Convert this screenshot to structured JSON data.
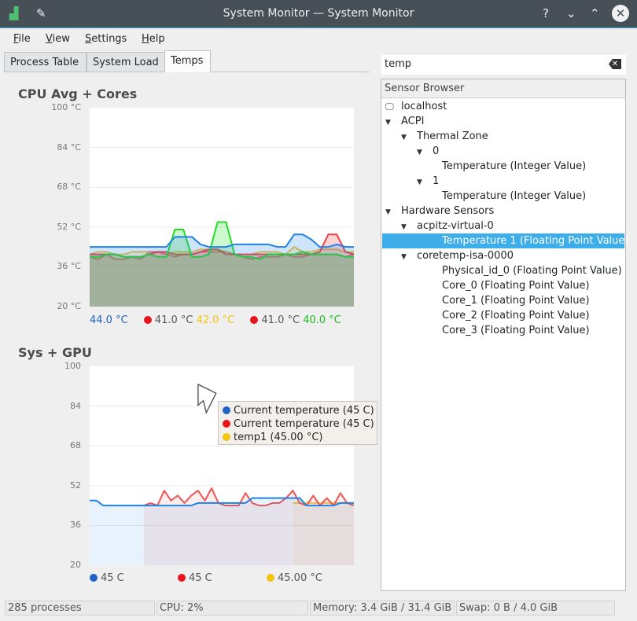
{
  "window": {
    "title": "System Monitor — System Monitor",
    "controls": [
      "?",
      "⌄",
      "⌃",
      "✕"
    ]
  },
  "menu": [
    "File",
    "View",
    "Settings",
    "Help"
  ],
  "tabs": [
    "Process Table",
    "System Load",
    "Temps"
  ],
  "active_tab": "Temps",
  "search": {
    "value": "temp"
  },
  "sensor_browser": {
    "header": "Sensor Browser",
    "items": [
      {
        "label": "localhost",
        "level": 0,
        "icon": "computer-icon"
      },
      {
        "label": "ACPI",
        "level": 0,
        "expanded": true
      },
      {
        "label": "Thermal Zone",
        "level": 1,
        "expanded": true
      },
      {
        "label": "0",
        "level": 2,
        "expanded": true
      },
      {
        "label": "Temperature (Integer Value)",
        "level": 3
      },
      {
        "label": "1",
        "level": 2,
        "expanded": true
      },
      {
        "label": "Temperature (Integer Value)",
        "level": 3
      },
      {
        "label": "Hardware Sensors",
        "level": 0,
        "expanded": true
      },
      {
        "label": "acpitz-virtual-0",
        "level": 1,
        "expanded": true
      },
      {
        "label": "Temperature 1 (Floating Point Value)",
        "level": 3,
        "selected": true
      },
      {
        "label": "coretemp-isa-0000",
        "level": 1,
        "expanded": true
      },
      {
        "label": "Physical_id_0 (Floating Point Value)",
        "level": 3
      },
      {
        "label": "Core_0 (Floating Point Value)",
        "level": 3
      },
      {
        "label": "Core_1 (Floating Point Value)",
        "level": 3
      },
      {
        "label": "Core_2 (Floating Point Value)",
        "level": 3
      },
      {
        "label": "Core_3 (Floating Point Value)",
        "level": 3
      }
    ]
  },
  "status": [
    "285 processes",
    "CPU: 2%",
    "Memory: 3.4 GiB / 31.4 GiB",
    "Swap: 0 B / 4.0 GiB"
  ],
  "tooltip": [
    {
      "label": "Current temperature (45 C)",
      "color": "#1d63c4"
    },
    {
      "label": "Current temperature (45 C)",
      "color": "#e8141b"
    },
    {
      "label": "temp1 (45.00 °C)",
      "color": "#f2c30f"
    }
  ],
  "chart_data": [
    {
      "type": "line",
      "title": "CPU Avg + Cores",
      "ylim": [
        20,
        100
      ],
      "yticks": [
        "100 °C",
        "84 °C",
        "68 °C",
        "52 °C",
        "36 °C",
        "20 °C"
      ],
      "grid": true,
      "legend": [
        {
          "value": "44.0 °C",
          "color": "#1d63c4",
          "dot": false
        },
        {
          "value": "41.0 °C",
          "color": "#e8141b",
          "dot": true
        },
        {
          "value": "42.0 °C",
          "color": "#f2c30f",
          "dot": false
        },
        {
          "value": "41.0 °C",
          "color": "#e8141b",
          "dot": true
        },
        {
          "value": "40.0 °C",
          "color": "#1bbf18",
          "dot": false
        }
      ],
      "series": [
        {
          "color": "#f4c542",
          "values": [
            41,
            42,
            42,
            41,
            41,
            42,
            42,
            42,
            42,
            41,
            42,
            42,
            42,
            43,
            43,
            43,
            42,
            41,
            41,
            41,
            42,
            42,
            42,
            41,
            44,
            42,
            42,
            43,
            43,
            43,
            42,
            42
          ]
        },
        {
          "color": "#ef7070",
          "values": [
            40,
            39,
            41,
            39,
            39,
            40,
            39,
            42,
            42,
            41,
            40,
            41,
            41,
            42,
            42,
            42,
            42,
            41,
            40,
            39,
            40,
            40,
            40,
            41,
            40,
            40,
            41,
            41,
            41,
            41,
            40,
            41
          ]
        },
        {
          "color": "#ee4040",
          "values": [
            41,
            41,
            41,
            41,
            40,
            40,
            40,
            41,
            42,
            42,
            41,
            41,
            41,
            42,
            43,
            43,
            41,
            41,
            41,
            41,
            41,
            41,
            41,
            41,
            41,
            41,
            41,
            42,
            49,
            49,
            42,
            41
          ]
        },
        {
          "color": "#22dd22",
          "values": [
            40,
            40,
            41,
            41,
            40,
            40,
            40,
            41,
            40,
            40,
            51,
            51,
            40,
            40,
            41,
            54,
            54,
            41,
            40,
            40,
            39,
            41,
            41,
            41,
            41,
            42,
            41,
            41,
            41,
            41,
            40,
            40
          ]
        },
        {
          "color": "#1e82e6",
          "values": [
            44,
            44,
            44,
            44,
            44,
            44,
            44,
            44,
            44,
            44,
            48,
            48,
            48,
            45,
            44,
            44,
            44,
            45,
            45,
            45,
            45,
            45,
            44,
            44,
            49,
            49,
            47,
            44,
            44,
            45,
            44,
            44
          ]
        }
      ]
    },
    {
      "type": "line",
      "title": "Sys + GPU",
      "ylim": [
        20,
        100
      ],
      "yticks": [
        "100",
        "84",
        "68",
        "52",
        "36",
        "20"
      ],
      "grid": true,
      "legend": [
        {
          "value": "45 C",
          "color": "#1d63c4",
          "dot": true
        },
        {
          "value": "45 C",
          "color": "#e8141b",
          "dot": true
        },
        {
          "value": "45.00 °C",
          "color": "#f2c30f",
          "dot": true
        }
      ],
      "series": [
        {
          "color": "#f4c542",
          "values": [
            null,
            null,
            null,
            null,
            null,
            null,
            null,
            null,
            null,
            null,
            null,
            null,
            null,
            null,
            null,
            null,
            null,
            null,
            null,
            null,
            null,
            null,
            null,
            null,
            null,
            null,
            null,
            null,
            null,
            null,
            45,
            45,
            45,
            45,
            45,
            45,
            45,
            45,
            45,
            45
          ]
        },
        {
          "color": "#ee5555",
          "values": [
            null,
            null,
            null,
            null,
            null,
            null,
            null,
            null,
            44,
            45,
            44,
            50,
            46,
            48,
            45,
            48,
            50,
            46,
            51,
            45,
            44,
            44,
            44,
            49,
            45,
            44,
            44,
            45,
            45,
            47,
            50,
            45,
            44,
            48,
            44,
            47,
            44,
            49,
            45,
            44
          ]
        },
        {
          "color": "#1e82e6",
          "values": [
            46,
            46,
            44,
            44,
            44,
            44,
            44,
            44,
            44,
            44,
            44,
            44,
            44,
            44,
            44,
            44,
            45,
            45,
            45,
            45,
            45,
            45,
            45,
            45,
            47,
            47,
            47,
            47,
            47,
            47,
            47,
            47,
            44,
            44,
            44,
            44,
            44,
            45,
            45,
            45
          ]
        }
      ]
    }
  ]
}
